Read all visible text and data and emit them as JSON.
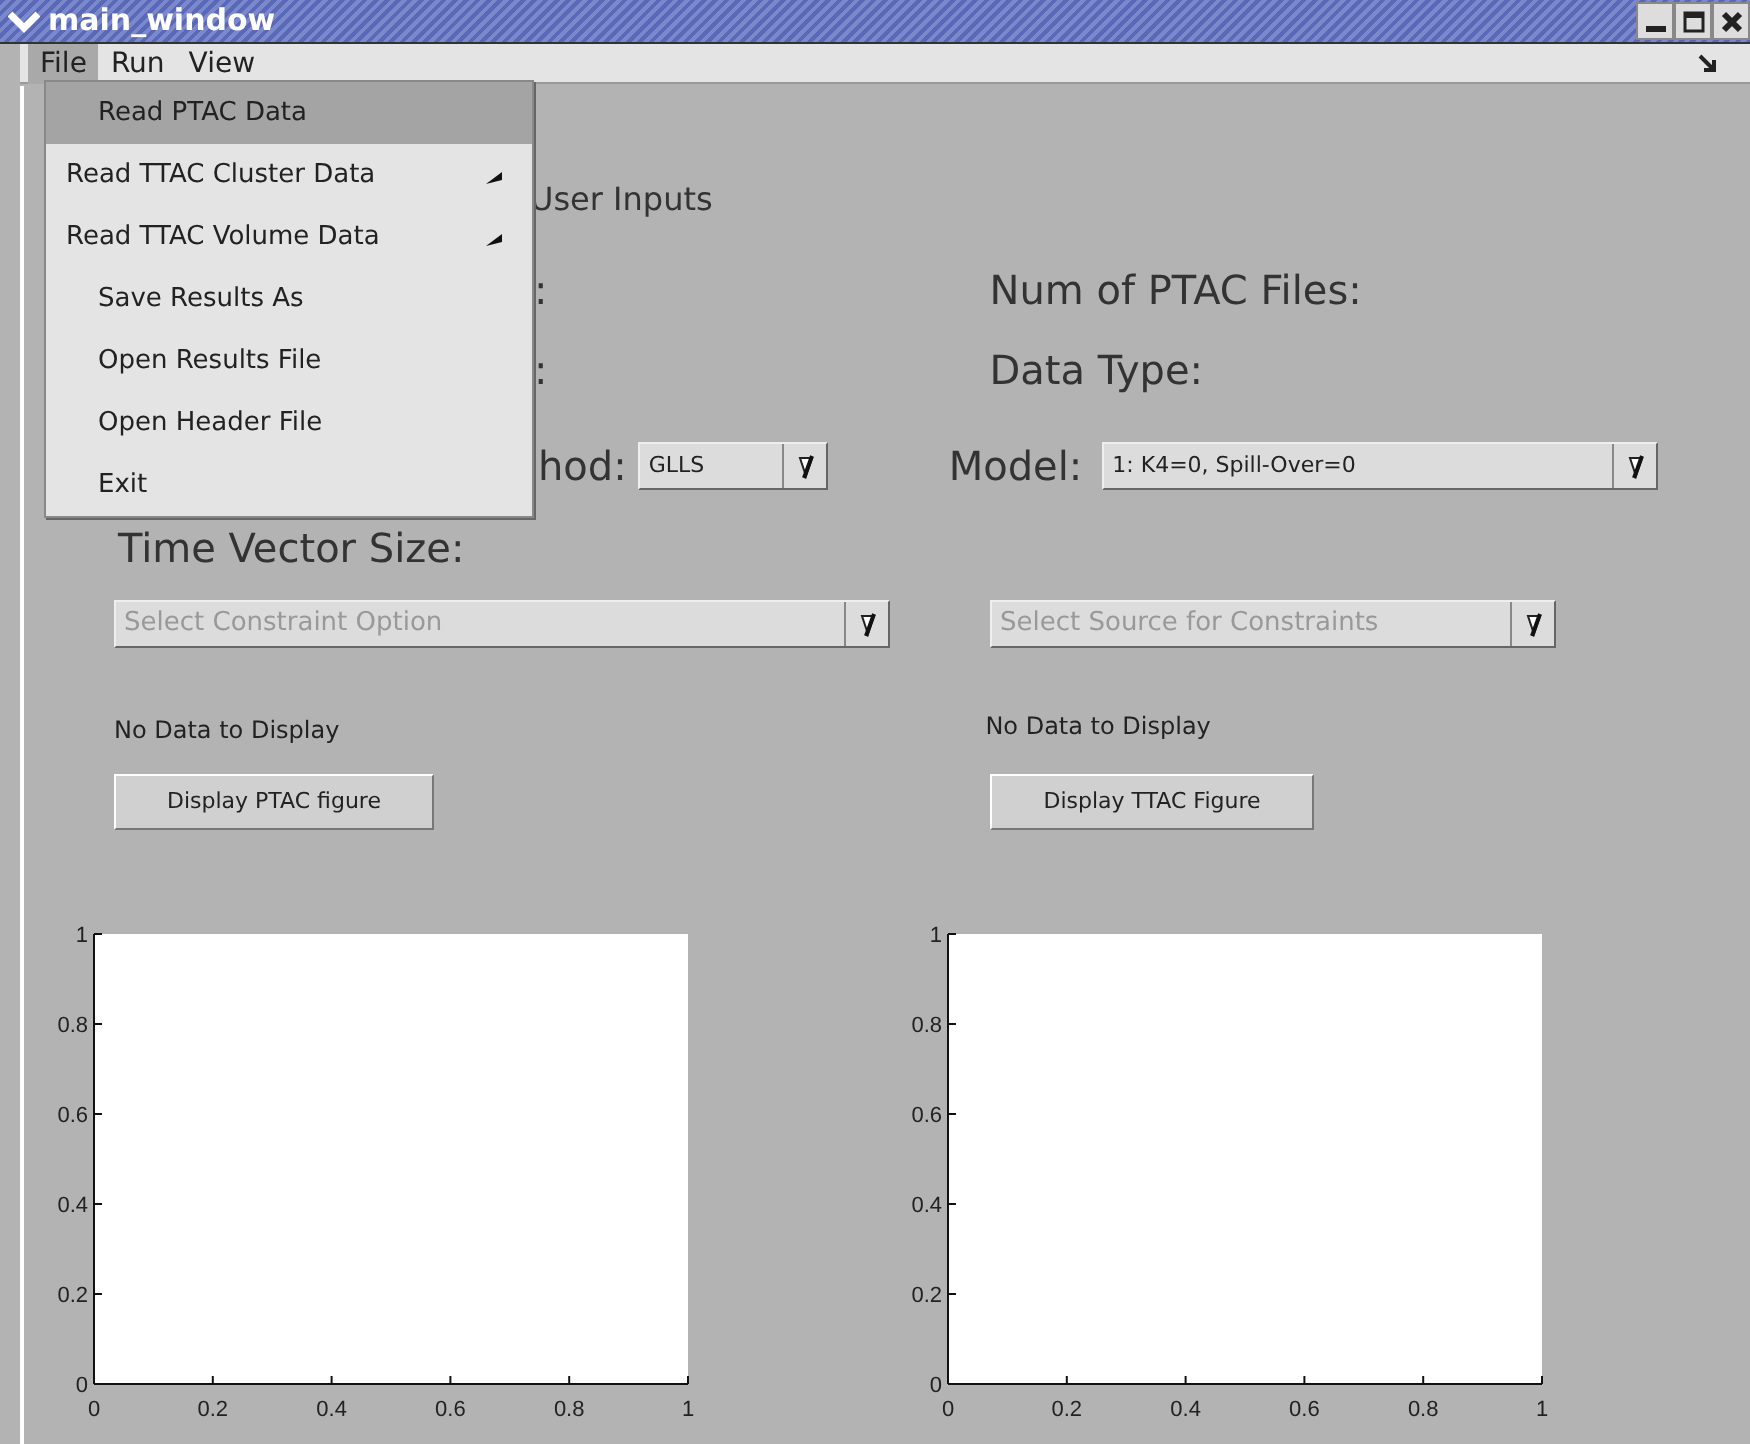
{
  "window": {
    "title": "main_window"
  },
  "menu_bar": [
    {
      "label": "File",
      "selected": true
    },
    {
      "label": "Run",
      "selected": false
    },
    {
      "label": "View",
      "selected": false
    }
  ],
  "file_menu": [
    {
      "label": "Read PTAC Data",
      "kind": "action",
      "selected": true
    },
    {
      "label": "Read TTAC Cluster Data",
      "kind": "submenu",
      "selected": false
    },
    {
      "label": "Read TTAC Volume Data",
      "kind": "submenu",
      "selected": false
    },
    {
      "label": "Save Results As",
      "kind": "action",
      "selected": false
    },
    {
      "label": "Open Results File",
      "kind": "action",
      "selected": false
    },
    {
      "label": "Open Header File",
      "kind": "action",
      "selected": false
    },
    {
      "label": "Exit",
      "kind": "action",
      "selected": false
    }
  ],
  "left_panel": {
    "heading": "User Inputs",
    "row_1": ":",
    "row_2": ":",
    "method_label": "hod:",
    "method_value": "GLLS",
    "time_vector_label": "Time Vector Size:",
    "constraint": {
      "placeholder": "Select Constraint Option"
    },
    "status": "No Data to Display",
    "button": "Display PTAC figure",
    "chart_data": {
      "type": "line",
      "xlim": [
        0,
        1
      ],
      "ylim": [
        0,
        1
      ],
      "xticks": [
        0,
        0.2,
        0.4,
        0.6,
        0.8,
        1
      ],
      "yticks": [
        0,
        0.2,
        0.4,
        0.6,
        0.8,
        1
      ]
    }
  },
  "right_panel": {
    "num_files_label": "Num of PTAC Files:",
    "data_type_label": "Data Type:",
    "model_label": "Model:",
    "model_value": "1: K4=0, Spill-Over=0",
    "constraint": {
      "placeholder": "Select Source for Constraints"
    },
    "status": "No Data to Display",
    "button": "Display TTAC Figure",
    "chart_data": {
      "type": "line",
      "xlim": [
        0,
        1
      ],
      "ylim": [
        0,
        1
      ],
      "xticks": [
        0,
        0.2,
        0.4,
        0.6,
        0.8,
        1
      ],
      "yticks": [
        0,
        0.2,
        0.4,
        0.6,
        0.8,
        1
      ]
    }
  }
}
